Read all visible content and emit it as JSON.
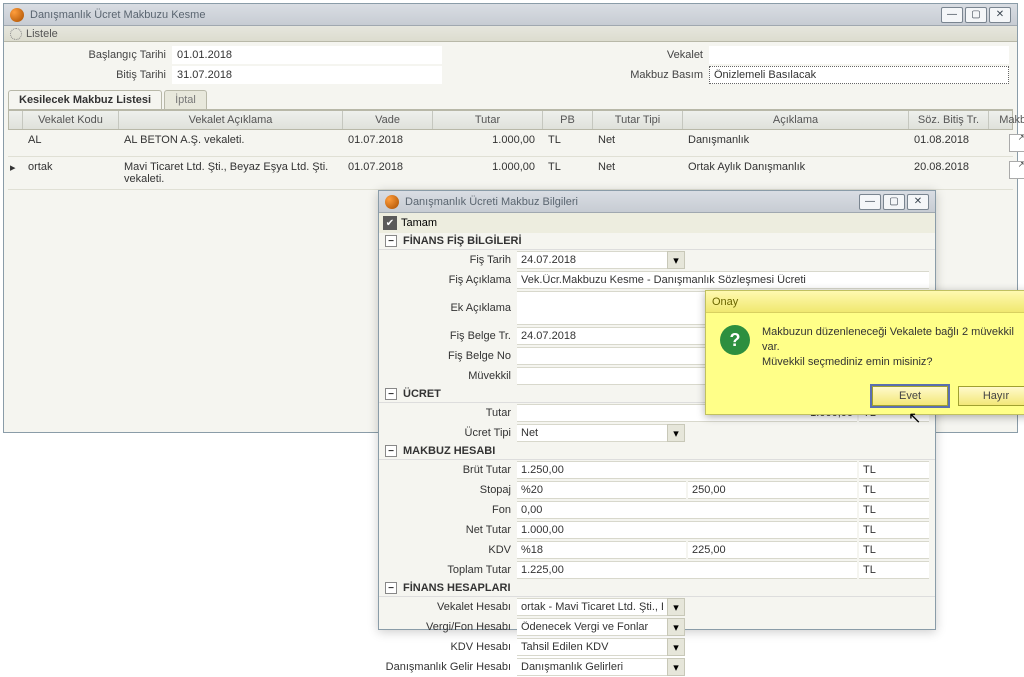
{
  "main": {
    "title": "Danışmanlık Ücret Makbuzu Kesme",
    "listele": "Listele",
    "filter": {
      "baslangic_label": "Başlangıç Tarihi",
      "baslangic": "01.01.2018",
      "bitis_label": "Bitiş Tarihi",
      "bitis": "31.07.2018",
      "vekalet_label": "Vekalet",
      "vekalet": "",
      "makbuz_basim_label": "Makbuz Basım",
      "makbuz_basim": "Önizlemeli Basılacak"
    },
    "tabs": {
      "active": "Kesilecek Makbuz Listesi",
      "inactive": "İptal"
    },
    "columns": {
      "vekalet_kodu": "Vekalet Kodu",
      "vekalet_aciklama": "Vekalet Açıklama",
      "vade": "Vade",
      "tutar": "Tutar",
      "pb": "PB",
      "tutar_tipi": "Tutar Tipi",
      "aciklama": "Açıklama",
      "soz_bitis": "Söz. Bitiş Tr.",
      "makbuz": "Makbuz"
    },
    "rows": [
      {
        "mark": "",
        "kod": "AL",
        "vekacik": "AL BETON A.Ş. vekaleti.",
        "vade": "01.07.2018",
        "tutar": "1.000,00",
        "pb": "TL",
        "tip": "Net",
        "acik": "Danışmanlık",
        "soz": "01.08.2018"
      },
      {
        "mark": "▸",
        "kod": "ortak",
        "vekacik": "Mavi Ticaret Ltd. Şti., Beyaz Eşya Ltd. Şti. vekaleti.",
        "vade": "01.07.2018",
        "tutar": "1.000,00",
        "pb": "TL",
        "tip": "Net",
        "acik": "Ortak Aylık Danışmanlık",
        "soz": "20.08.2018"
      }
    ]
  },
  "detail": {
    "title": "Danışmanlık Ücreti Makbuz Bilgileri",
    "tamam": "Tamam",
    "s1": "FİNANS FİŞ BİLGİLERİ",
    "fis_tarih_l": "Fiş Tarih",
    "fis_tarih": "24.07.2018",
    "fis_aciklama_l": "Fiş Açıklama",
    "fis_aciklama": "Vek.Ücr.Makbuzu Kesme - Danışmanlık Sözleşmesi Ücreti",
    "ek_aciklama_l": "Ek Açıklama",
    "ek_aciklama": "",
    "fis_belgetr_l": "Fiş Belge Tr.",
    "fis_belgetr": "24.07.2018",
    "fis_belgeno_l": "Fiş Belge No",
    "fis_belgeno": "",
    "muvekkil_l": "Müvekkil",
    "muvekkil": "",
    "s2": "ÜCRET",
    "tutar_l": "Tutar",
    "tutar": "1.000,00",
    "tutar_pb": "TL",
    "ucret_tipi_l": "Ücret Tipi",
    "ucret_tipi": "Net",
    "s3": "MAKBUZ HESABI",
    "brut_l": "Brüt Tutar",
    "brut": "1.250,00",
    "brut_pb": "TL",
    "stopaj_l": "Stopaj",
    "stopaj_pct": "%20",
    "stopaj": "250,00",
    "stopaj_pb": "TL",
    "fon_l": "Fon",
    "fon": "0,00",
    "fon_pb": "TL",
    "net_l": "Net Tutar",
    "net": "1.000,00",
    "net_pb": "TL",
    "kdv_l": "KDV",
    "kdv_pct": "%18",
    "kdv": "225,00",
    "kdv_pb": "TL",
    "toplam_l": "Toplam Tutar",
    "toplam": "1.225,00",
    "toplam_pb": "TL",
    "s4": "FİNANS HESAPLARI",
    "vek_hes_l": "Vekalet Hesabı",
    "vek_hes": "ortak - Mavi Ticaret Ltd. Şti., Beyaz Eşya Ltd. Şti. vekaleti. - Vekalet",
    "vergi_hes_l": "Vergi/Fon Hesabı",
    "vergi_hes": "Ödenecek Vergi ve Fonlar",
    "kdv_hes_l": "KDV Hesabı",
    "kdv_hes": "Tahsil Edilen KDV",
    "gelir_hes_l": "Danışmanlık Gelir Hesabı",
    "gelir_hes": "Danışmanlık Gelirleri"
  },
  "confirm": {
    "title": "Onay",
    "msg1": "Makbuzun düzenleneceği Vekalete bağlı 2 müvekkil var.",
    "msg2": "Müvekkil seçmediniz emin misiniz?",
    "evet": "Evet",
    "hayir": "Hayır"
  }
}
